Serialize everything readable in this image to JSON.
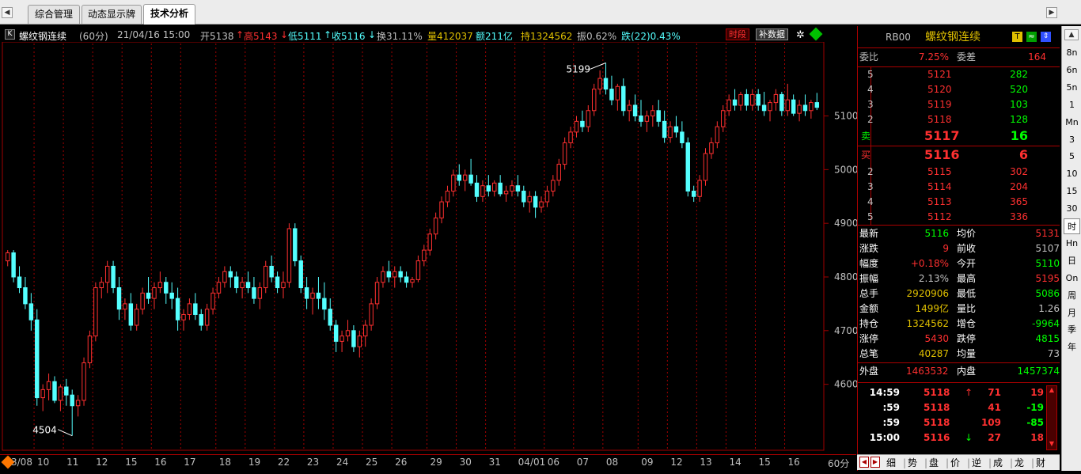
{
  "tabs": [
    {
      "label": "综合管理"
    },
    {
      "label": "动态显示牌"
    },
    {
      "label": "技术分析"
    }
  ],
  "chart_header": {
    "k_icon": "K",
    "name": "螺纹钢连续",
    "period": "(60分)",
    "datetime": "21/04/16 15:00",
    "open": "开5138",
    "high": "高5143",
    "low": "低5111",
    "close": "收5116",
    "turnover": "换31.11%",
    "volume": "量412037",
    "amount": "额211亿",
    "position": "持1324562",
    "amplitude": "振0.62%",
    "change": "跌(22)0.43%",
    "btn_weight": "时段",
    "btn_fill": "补数据"
  },
  "y_axis": {
    "ticks": [
      "5100",
      "5000",
      "4900",
      "4800",
      "4700",
      "4600"
    ]
  },
  "annotations": {
    "max_label": "5199",
    "min_label": "4504"
  },
  "date_axis": {
    "labels": [
      "3/08",
      "10",
      "11",
      "12",
      "15",
      "16",
      "17",
      "18",
      "19",
      "22",
      "23",
      "24",
      "25",
      "26",
      "29",
      "30",
      "31",
      "04/01",
      "06",
      "07",
      "08",
      "09",
      "12",
      "13",
      "14",
      "15",
      "16"
    ],
    "period": "60分"
  },
  "quote": {
    "code": "RB00",
    "name": "螺纹钢连续",
    "ratio_label": "委比",
    "ratio_value": "7.25%",
    "diff_label": "委差",
    "diff_value": "164",
    "asks": [
      {
        "level": "5",
        "price": "5121",
        "vol": "282"
      },
      {
        "level": "4",
        "price": "5120",
        "vol": "520"
      },
      {
        "level": "3",
        "price": "5119",
        "vol": "103"
      },
      {
        "level": "2",
        "price": "5118",
        "vol": "128"
      }
    ],
    "sell1": {
      "label": "卖",
      "price": "5117",
      "vol": "16"
    },
    "buy1": {
      "label": "买",
      "price": "5116",
      "vol": "6"
    },
    "bids": [
      {
        "level": "2",
        "price": "5115",
        "vol": "302"
      },
      {
        "level": "3",
        "price": "5114",
        "vol": "204"
      },
      {
        "level": "4",
        "price": "5113",
        "vol": "365"
      },
      {
        "level": "5",
        "price": "5112",
        "vol": "336"
      }
    ],
    "stats": [
      {
        "l1": "最新",
        "v1": "5116",
        "c1": "#00ff00",
        "l2": "均价",
        "v2": "5131",
        "c2": "#ff3030"
      },
      {
        "l1": "涨跌",
        "v1": "9",
        "c1": "#ff3030",
        "l2": "前收",
        "v2": "5107",
        "c2": "#c0c0c0"
      },
      {
        "l1": "幅度",
        "v1": "+0.18%",
        "c1": "#ff3030",
        "l2": "今开",
        "v2": "5110",
        "c2": "#00ff00"
      },
      {
        "l1": "振幅",
        "v1": "2.13%",
        "c1": "#c0c0c0",
        "l2": "最高",
        "v2": "5195",
        "c2": "#ff3030"
      },
      {
        "l1": "总手",
        "v1": "2920906",
        "c1": "#e0c000",
        "l2": "最低",
        "v2": "5086",
        "c2": "#00ff00"
      },
      {
        "l1": "金额",
        "v1": "1499亿",
        "c1": "#e0c000",
        "l2": "量比",
        "v2": "1.26",
        "c2": "#c0c0c0"
      },
      {
        "l1": "持仓",
        "v1": "1324562",
        "c1": "#e0c000",
        "l2": "增仓",
        "v2": "-9964",
        "c2": "#00ff00"
      },
      {
        "l1": "涨停",
        "v1": "5430",
        "c1": "#ff3030",
        "l2": "跌停",
        "v2": "4815",
        "c2": "#00ff00"
      },
      {
        "l1": "总笔",
        "v1": "40287",
        "c1": "#e0c000",
        "l2": "均量",
        "v2": "73",
        "c2": "#c0c0c0"
      }
    ],
    "outer_label": "外盘",
    "outer_value": "1463532",
    "inner_label": "内盘",
    "inner_value": "1457374",
    "ticks": [
      {
        "time": "14:59",
        "price": "5118",
        "arrow": "↑",
        "vol": "71",
        "chg": "19",
        "chg_color": "#ff3030",
        "arrow_color": "#ff3030"
      },
      {
        "time": ":59",
        "price": "5118",
        "arrow": "",
        "vol": "41",
        "chg": "-19",
        "chg_color": "#00ff00",
        "arrow_color": "#ff3030"
      },
      {
        "time": ":59",
        "price": "5118",
        "arrow": "",
        "vol": "109",
        "chg": "-85",
        "chg_color": "#00ff00",
        "arrow_color": "#ff3030"
      },
      {
        "time": "15:00",
        "price": "5116",
        "arrow": "↓",
        "vol": "27",
        "chg": "18",
        "chg_color": "#ff3030",
        "arrow_color": "#00ff00"
      }
    ],
    "detail_tabs": [
      "细",
      "势",
      "盘",
      "价",
      "逆",
      "成",
      "龙",
      "财"
    ]
  },
  "sidebar": [
    "8n",
    "6n",
    "5n",
    "1",
    "Mn",
    "3",
    "5",
    "10",
    "15",
    "30",
    "时",
    "Hn",
    "日",
    "On",
    "周",
    "月",
    "季",
    "年"
  ],
  "colors": {
    "up": "#ff3030",
    "down": "#54ffff",
    "grid": "#a00000",
    "yellow": "#e0c000",
    "green": "#00ff00"
  },
  "chart_data": {
    "type": "candlestick",
    "period": "60分",
    "ylim": [
      4480,
      5235
    ],
    "yticks": [
      4600,
      4700,
      4800,
      4900,
      5000,
      5100
    ],
    "candles": [
      [
        4830,
        4850,
        4820,
        4845
      ],
      [
        4845,
        4850,
        4790,
        4800
      ],
      [
        4800,
        4820,
        4770,
        4780
      ],
      [
        4780,
        4800,
        4740,
        4750
      ],
      [
        4750,
        4770,
        4700,
        4720
      ],
      [
        4720,
        4740,
        4560,
        4575
      ],
      [
        4575,
        4600,
        4550,
        4590
      ],
      [
        4590,
        4620,
        4570,
        4605
      ],
      [
        4605,
        4615,
        4565,
        4570
      ],
      [
        4570,
        4600,
        4550,
        4595
      ],
      [
        4595,
        4610,
        4560,
        4580
      ],
      [
        4580,
        4590,
        4504,
        4560
      ],
      [
        4560,
        4580,
        4540,
        4570
      ],
      [
        4570,
        4650,
        4560,
        4640
      ],
      [
        4640,
        4700,
        4630,
        4690
      ],
      [
        4690,
        4790,
        4680,
        4780
      ],
      [
        4780,
        4800,
        4760,
        4790
      ],
      [
        4790,
        4830,
        4770,
        4820
      ],
      [
        4820,
        4830,
        4770,
        4780
      ],
      [
        4780,
        4800,
        4720,
        4740
      ],
      [
        4740,
        4760,
        4720,
        4750
      ],
      [
        4750,
        4770,
        4700,
        4710
      ],
      [
        4710,
        4750,
        4700,
        4740
      ],
      [
        4740,
        4780,
        4730,
        4770
      ],
      [
        4770,
        4800,
        4750,
        4760
      ],
      [
        4760,
        4790,
        4740,
        4780
      ],
      [
        4780,
        4810,
        4770,
        4790
      ],
      [
        4790,
        4800,
        4750,
        4770
      ],
      [
        4770,
        4790,
        4740,
        4760
      ],
      [
        4760,
        4780,
        4700,
        4720
      ],
      [
        4720,
        4740,
        4700,
        4730
      ],
      [
        4730,
        4760,
        4720,
        4750
      ],
      [
        4750,
        4770,
        4720,
        4730
      ],
      [
        4730,
        4740,
        4700,
        4710
      ],
      [
        4710,
        4750,
        4700,
        4740
      ],
      [
        4740,
        4780,
        4730,
        4770
      ],
      [
        4770,
        4800,
        4760,
        4790
      ],
      [
        4790,
        4820,
        4780,
        4810
      ],
      [
        4810,
        4820,
        4780,
        4800
      ],
      [
        4800,
        4810,
        4770,
        4780
      ],
      [
        4780,
        4800,
        4760,
        4790
      ],
      [
        4790,
        4810,
        4770,
        4780
      ],
      [
        4780,
        4800,
        4750,
        4760
      ],
      [
        4760,
        4790,
        4740,
        4780
      ],
      [
        4780,
        4830,
        4770,
        4820
      ],
      [
        4820,
        4840,
        4790,
        4800
      ],
      [
        4800,
        4810,
        4770,
        4780
      ],
      [
        4780,
        4810,
        4760,
        4790
      ],
      [
        4790,
        4900,
        4780,
        4890
      ],
      [
        4890,
        4900,
        4820,
        4830
      ],
      [
        4830,
        4840,
        4770,
        4780
      ],
      [
        4780,
        4800,
        4740,
        4760
      ],
      [
        4760,
        4780,
        4730,
        4770
      ],
      [
        4770,
        4800,
        4740,
        4760
      ],
      [
        4760,
        4790,
        4720,
        4740
      ],
      [
        4740,
        4760,
        4700,
        4710
      ],
      [
        4710,
        4720,
        4660,
        4680
      ],
      [
        4680,
        4700,
        4660,
        4690
      ],
      [
        4690,
        4720,
        4680,
        4700
      ],
      [
        4700,
        4710,
        4660,
        4670
      ],
      [
        4670,
        4700,
        4650,
        4690
      ],
      [
        4690,
        4720,
        4670,
        4710
      ],
      [
        4710,
        4760,
        4700,
        4750
      ],
      [
        4750,
        4800,
        4740,
        4790
      ],
      [
        4790,
        4820,
        4780,
        4810
      ],
      [
        4810,
        4830,
        4790,
        4800
      ],
      [
        4800,
        4820,
        4780,
        4810
      ],
      [
        4810,
        4820,
        4790,
        4800
      ],
      [
        4800,
        4810,
        4780,
        4790
      ],
      [
        4790,
        4800,
        4780,
        4795
      ],
      [
        4795,
        4840,
        4790,
        4830
      ],
      [
        4830,
        4860,
        4820,
        4850
      ],
      [
        4850,
        4890,
        4840,
        4880
      ],
      [
        4880,
        4920,
        4870,
        4910
      ],
      [
        4910,
        4950,
        4900,
        4940
      ],
      [
        4940,
        4970,
        4930,
        4960
      ],
      [
        4960,
        5000,
        4950,
        4990
      ],
      [
        4990,
        5010,
        4970,
        4980
      ],
      [
        4980,
        5000,
        4960,
        4990
      ],
      [
        4990,
        5020,
        4970,
        4975
      ],
      [
        4975,
        4990,
        4940,
        4950
      ],
      [
        4950,
        4980,
        4940,
        4970
      ],
      [
        4970,
        4990,
        4950,
        4960
      ],
      [
        4960,
        4980,
        4950,
        4975
      ],
      [
        4975,
        4990,
        4950,
        4955
      ],
      [
        4955,
        4970,
        4940,
        4960
      ],
      [
        4960,
        4980,
        4950,
        4970
      ],
      [
        4970,
        4990,
        4950,
        4960
      ],
      [
        4960,
        4970,
        4930,
        4940
      ],
      [
        4940,
        4960,
        4920,
        4950
      ],
      [
        4950,
        4960,
        4910,
        4930
      ],
      [
        4930,
        4950,
        4920,
        4940
      ],
      [
        4940,
        4970,
        4930,
        4960
      ],
      [
        4960,
        4990,
        4950,
        4980
      ],
      [
        4980,
        5020,
        4970,
        5010
      ],
      [
        5010,
        5060,
        5000,
        5050
      ],
      [
        5050,
        5080,
        5040,
        5070
      ],
      [
        5070,
        5100,
        5060,
        5090
      ],
      [
        5090,
        5110,
        5070,
        5080
      ],
      [
        5080,
        5120,
        5070,
        5110
      ],
      [
        5110,
        5160,
        5100,
        5150
      ],
      [
        5150,
        5185,
        5140,
        5170
      ],
      [
        5170,
        5199,
        5140,
        5150
      ],
      [
        5150,
        5175,
        5120,
        5130
      ],
      [
        5130,
        5160,
        5110,
        5155
      ],
      [
        5155,
        5170,
        5100,
        5110
      ],
      [
        5110,
        5130,
        5090,
        5120
      ],
      [
        5120,
        5140,
        5090,
        5100
      ],
      [
        5100,
        5130,
        5080,
        5090
      ],
      [
        5090,
        5110,
        5070,
        5100
      ],
      [
        5100,
        5120,
        5080,
        5110
      ],
      [
        5110,
        5130,
        5080,
        5090
      ],
      [
        5090,
        5110,
        5050,
        5060
      ],
      [
        5060,
        5090,
        5050,
        5080
      ],
      [
        5080,
        5100,
        5060,
        5070
      ],
      [
        5070,
        5090,
        5040,
        5050
      ],
      [
        5050,
        5060,
        4950,
        4960
      ],
      [
        4960,
        4970,
        4940,
        4950
      ],
      [
        4950,
        4990,
        4940,
        4980
      ],
      [
        4980,
        5040,
        4970,
        5030
      ],
      [
        5030,
        5060,
        5020,
        5050
      ],
      [
        5050,
        5090,
        5040,
        5080
      ],
      [
        5080,
        5120,
        5070,
        5110
      ],
      [
        5110,
        5140,
        5100,
        5130
      ],
      [
        5130,
        5150,
        5110,
        5120
      ],
      [
        5120,
        5145,
        5110,
        5140
      ],
      [
        5140,
        5150,
        5110,
        5120
      ],
      [
        5120,
        5150,
        5110,
        5140
      ],
      [
        5140,
        5150,
        5110,
        5120
      ],
      [
        5120,
        5145,
        5100,
        5110
      ],
      [
        5110,
        5130,
        5090,
        5125
      ],
      [
        5125,
        5150,
        5110,
        5140
      ],
      [
        5140,
        5145,
        5100,
        5110
      ],
      [
        5110,
        5160,
        5100,
        5130
      ],
      [
        5130,
        5140,
        5100,
        5105
      ],
      [
        5105,
        5130,
        5090,
        5120
      ],
      [
        5120,
        5140,
        5100,
        5110
      ],
      [
        5110,
        5130,
        5095,
        5125
      ],
      [
        5125,
        5143,
        5111,
        5116
      ]
    ]
  }
}
